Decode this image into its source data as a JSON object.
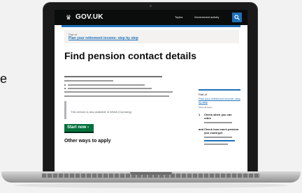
{
  "left_letter": "e",
  "header": {
    "logo": "GOV.UK",
    "topics_label": "Topics",
    "gov_activity_label": "Government activity",
    "search_icon": "search-icon"
  },
  "breadcrumb": {
    "part_label": "Part of",
    "link": "Plan your retirement income: step by step"
  },
  "page_title": "Find pension contact details",
  "inset_text": "This service is also available in Welsh (Cymraeg)",
  "start_button": "Start now",
  "other_heading": "Other ways to apply",
  "sidebar": {
    "part_label": "Part of",
    "link": "Plan your retirement income: step by step",
    "show_all": "Show all steps",
    "steps": [
      {
        "num": "1",
        "title": "Check when you can retire"
      },
      {
        "num": "and",
        "title": "Check how much pension you could get"
      }
    ]
  },
  "colors": {
    "header": "#0b0c0c",
    "link": "#1d70b8",
    "start": "#00703c"
  }
}
